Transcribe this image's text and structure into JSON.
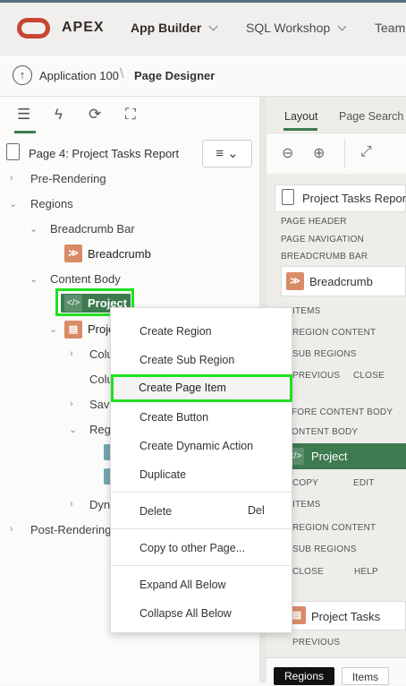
{
  "header": {
    "brand": "APEX",
    "nav": [
      {
        "label": "App Builder"
      },
      {
        "label": "SQL Workshop"
      },
      {
        "label": "Team"
      }
    ]
  },
  "breadcrumb": {
    "app": "Application 100",
    "current": "Page Designer"
  },
  "left": {
    "page_title": "Page 4: Project Tasks Report",
    "tree": {
      "pre_rendering": "Pre-Rendering",
      "regions": "Regions",
      "breadcrumb_bar": "Breadcrumb Bar",
      "breadcrumb": "Breadcrumb",
      "content_body": "Content Body",
      "project": "Project",
      "proj_partial": "Proje",
      "colu1": "Colu",
      "colu2": "Colu",
      "save": "Save",
      "regi": "Regi",
      "dyna": "Dyna",
      "post_rendering": "Post-Rendering"
    }
  },
  "context_menu": {
    "create_region": "Create Region",
    "create_sub_region": "Create Sub Region",
    "create_page_item": "Create Page Item",
    "create_button": "Create Button",
    "create_dynamic_action": "Create Dynamic Action",
    "duplicate": "Duplicate",
    "delete": "Delete",
    "delete_shortcut": "Del",
    "copy_to_other_page": "Copy to other Page...",
    "expand_all_below": "Expand All Below",
    "collapse_all_below": "Collapse All Below"
  },
  "right": {
    "tabs": [
      {
        "label": "Layout"
      },
      {
        "label": "Page Search"
      }
    ],
    "page_card": "Project Tasks Report",
    "labels": {
      "page_header": "PAGE HEADER",
      "page_navigation": "PAGE NAVIGATION",
      "breadcrumb_bar": "BREADCRUMB BAR",
      "items1": "ITEMS",
      "region_content1": "REGION CONTENT",
      "sub_regions1": "SUB REGIONS",
      "previous1": "PREVIOUS",
      "close1": "CLOSE",
      "before_content_body": "FORE CONTENT BODY",
      "content_body": "ONTENT BODY",
      "copy": "COPY",
      "edit": "EDIT",
      "items2": "ITEMS",
      "region_content2": "REGION CONTENT",
      "sub_regions2": "SUB REGIONS",
      "close2": "CLOSE",
      "help": "HELP",
      "previous2": "PREVIOUS"
    },
    "breadcrumb_card": "Breadcrumb",
    "project_card": "Project",
    "project_tasks_card": "Project Tasks"
  },
  "bottom_tabs": [
    {
      "label": "Regions"
    },
    {
      "label": "Items"
    }
  ]
}
